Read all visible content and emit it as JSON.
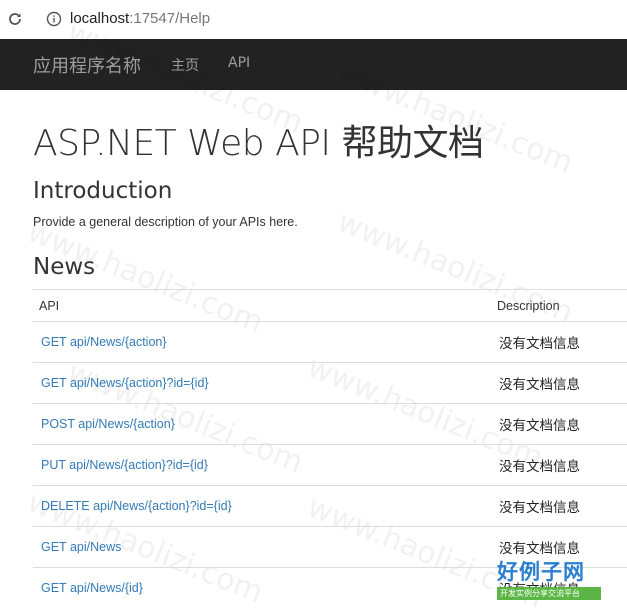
{
  "browser": {
    "url_host": "localhost",
    "url_path": ":17547/Help"
  },
  "navbar": {
    "brand": "应用程序名称",
    "links": [
      "主页",
      "API"
    ]
  },
  "page": {
    "title": "ASP.NET Web API 帮助文档",
    "intro_heading": "Introduction",
    "intro_text": "Provide a general description of your APIs here.",
    "section_heading": "News"
  },
  "table": {
    "headers": [
      "API",
      "Description"
    ],
    "rows": [
      {
        "api": "GET api/News/{action}",
        "description": "没有文档信息"
      },
      {
        "api": "GET api/News/{action}?id={id}",
        "description": "没有文档信息"
      },
      {
        "api": "POST api/News/{action}",
        "description": "没有文档信息"
      },
      {
        "api": "PUT api/News/{action}?id={id}",
        "description": "没有文档信息"
      },
      {
        "api": "DELETE api/News/{action}?id={id}",
        "description": "没有文档信息"
      },
      {
        "api": "GET api/News",
        "description": "没有文档信息"
      },
      {
        "api": "GET api/News/{id}",
        "description": "没有文档信息"
      }
    ]
  },
  "watermark": {
    "text": "www.haolizi.com",
    "logo_main": "好例子网",
    "logo_sub": "开发实例分享交流平台"
  }
}
